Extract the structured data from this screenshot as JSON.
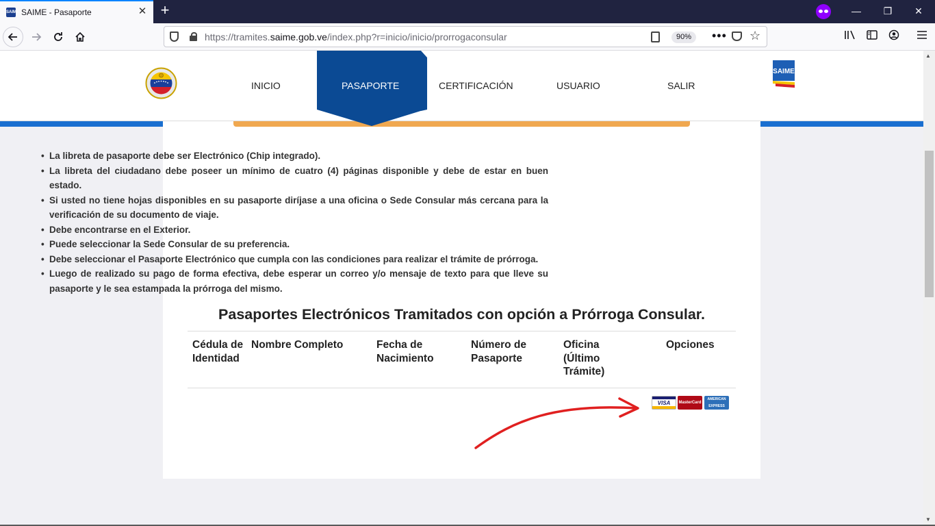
{
  "browser": {
    "tab_title": "SAIME - Pasaporte",
    "tab_favicon_text": "SAIME",
    "new_tab": "+",
    "close_tab": "✕",
    "url_prefix": "https://tramites.",
    "url_host": "saime.gob.ve",
    "url_path": "/index.php?r=inicio/inicio/prorrogaconsular",
    "zoom": "90%",
    "window_minimize": "—",
    "window_restore": "❐",
    "window_close": "✕",
    "icons": [
      "back-arrow-icon",
      "forward-arrow-icon",
      "reload-icon",
      "home-icon",
      "shield-icon",
      "lock-icon",
      "reader-view-icon",
      "more-icon",
      "pocket-icon",
      "bookmark-star-icon",
      "library-icon",
      "sidebar-icon",
      "account-icon",
      "hamburger-menu-icon",
      "private-browsing-icon"
    ]
  },
  "site": {
    "menu": {
      "inicio": "INICIO",
      "pasaporte": "PASAPORTE",
      "certificacion": "CERTIFICACIÓN",
      "usuario": "USUARIO",
      "salir": "SALIR"
    },
    "saime_logo_text": "SAIME",
    "brand_colors": {
      "active_menu": "#0b4a94",
      "band": "#1a6fd0",
      "banner": "#f0a850",
      "arrow": "#e02020"
    }
  },
  "requirements": [
    "La libreta de pasaporte debe ser Electrónico (Chip integrado).",
    "La libreta del ciudadano debe poseer un mínimo de cuatro (4) páginas disponible y debe de estar en buen estado.",
    "Si usted no tiene hojas disponibles en su pasaporte diríjase a una oficina o Sede Consular más cercana para la verificación de su documento de viaje.",
    "Debe encontrarse en el Exterior.",
    "Puede seleccionar la Sede Consular de su preferencia.",
    "Debe seleccionar el Pasaporte Electrónico que cumpla con las condiciones para realizar el trámite de prórroga.",
    "Luego de realizado su pago de forma efectiva, debe esperar un correo y/o mensaje de texto para que lleve su pasaporte y le sea estampada la prórroga del mismo."
  ],
  "table": {
    "title": "Pasaportes Electrónicos Tramitados con opción a Prórroga Consular.",
    "headers": {
      "cedula": "Cédula de Identidad",
      "nombre": "Nombre Completo",
      "fecha": "Fecha de Nacimiento",
      "numero": "Número de Pasaporte",
      "oficina": "Oficina (Último Trámite)",
      "opciones": "Opciones"
    }
  },
  "payment_cards": {
    "visa": "VISA",
    "mastercard": "MasterCard",
    "amex": "AMERICAN EXPRESS"
  }
}
